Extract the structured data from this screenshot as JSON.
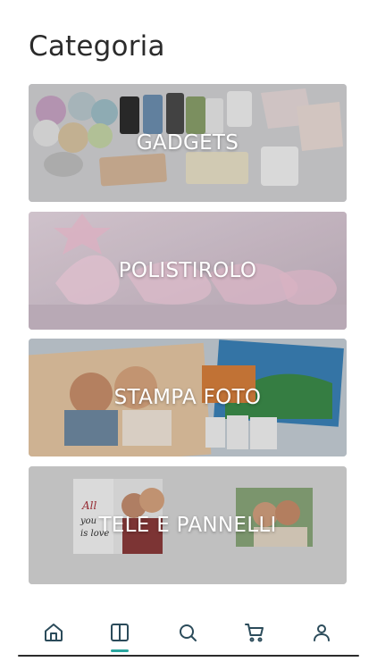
{
  "page": {
    "title": "Categoria"
  },
  "categories": [
    {
      "label": "GADGETS"
    },
    {
      "label": "POLISTIROLO"
    },
    {
      "label": "STAMPA FOTO"
    },
    {
      "label": "TELE E PANNELLI"
    }
  ],
  "bottom_nav": {
    "items": [
      {
        "icon": "home-icon"
      },
      {
        "icon": "book-icon",
        "active": true
      },
      {
        "icon": "search-icon"
      },
      {
        "icon": "cart-icon"
      },
      {
        "icon": "user-icon"
      }
    ],
    "active_color": "#2aa7a0",
    "icon_color": "#2b4b5a"
  }
}
